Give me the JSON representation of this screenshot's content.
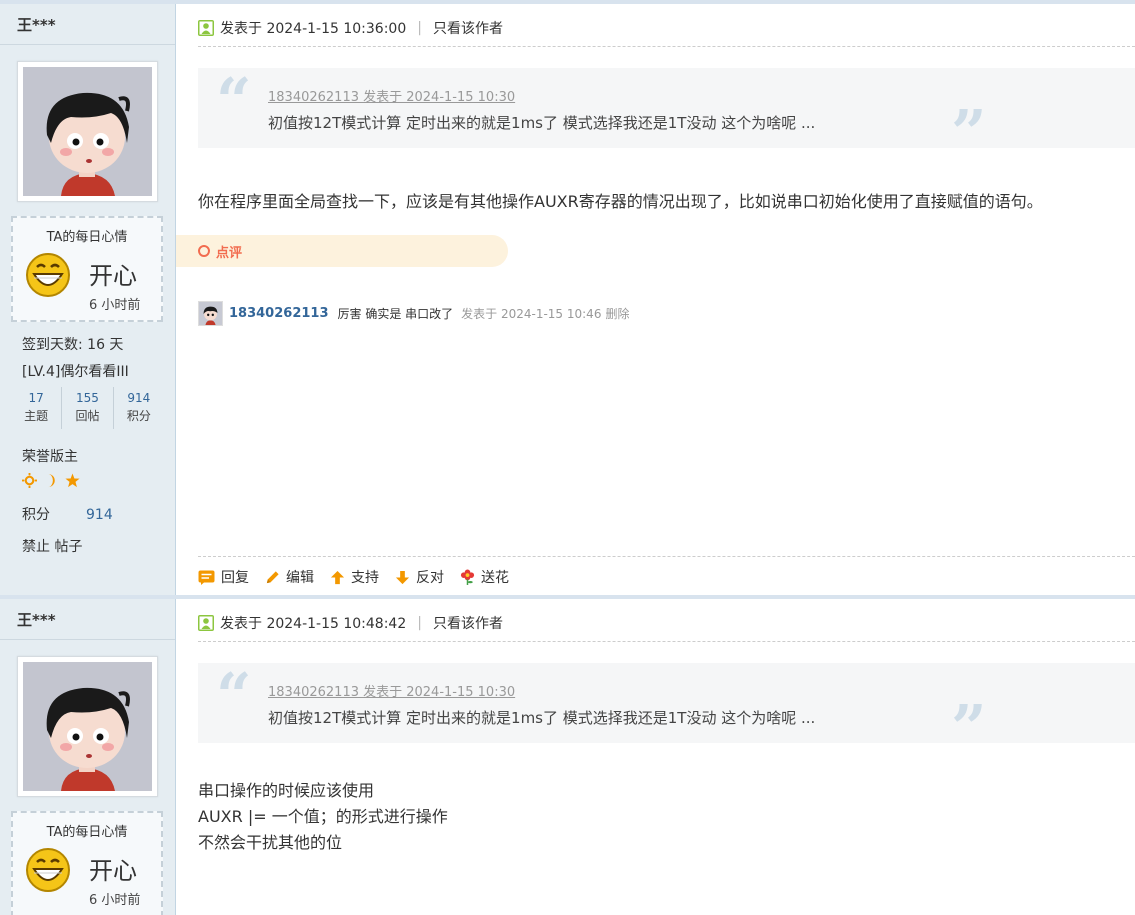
{
  "posts": [
    {
      "author": "王***",
      "mood": {
        "title": "TA的每日心情",
        "text": "开心",
        "time": "6 小时前"
      },
      "sign_days": "签到天数: 16 天",
      "level": "[LV.4]偶尔看看III",
      "stats": [
        {
          "value": "17",
          "label": "主题"
        },
        {
          "value": "155",
          "label": "回帖"
        },
        {
          "value": "914",
          "label": "积分"
        }
      ],
      "honor": "荣誉版主",
      "score_label": "积分",
      "score_value": "914",
      "ban": "禁止 帖子",
      "posted": "发表于 2024-1-15 10:36:00",
      "only_author": "只看该作者",
      "quote": {
        "author": "18340262113 发表于 2024-1-15 10:30",
        "text": "初值按12T模式计算   定时出来的就是1ms了  模式选择我还是1T没动  这个为啥呢 ..."
      },
      "body": "你在程序里面全局查找一下，应该是有其他操作AUXR寄存器的情况出现了，比如说串口初始化使用了直接赋值的语句。",
      "rate_label": "点评",
      "comment": {
        "user": "18340262113",
        "text": "厉害 确实是 串口改了",
        "time": "发表于 2024-1-15 10:46",
        "delete": "删除"
      },
      "actions": [
        "回复",
        "编辑",
        "支持",
        "反对",
        "送花"
      ]
    },
    {
      "author": "王***",
      "mood": {
        "title": "TA的每日心情",
        "text": "开心",
        "time": "6 小时前"
      },
      "posted": "发表于 2024-1-15 10:48:42",
      "only_author": "只看该作者",
      "quote": {
        "author": "18340262113 发表于 2024-1-15 10:30",
        "text": "初值按12T模式计算   定时出来的就是1ms了  模式选择我还是1T没动  这个为啥呢 ..."
      },
      "body_lines": [
        "串口操作的时候应该使用",
        "AUXR |= 一个值；的形式进行操作",
        "不然会干扰其他的位"
      ]
    }
  ],
  "colors": {
    "link": "#336699",
    "accent": "#f26c4f",
    "sidebar_bg": "#e5edf2"
  }
}
